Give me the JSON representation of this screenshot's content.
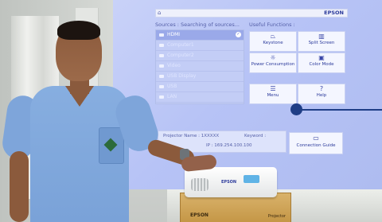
{
  "projection": {
    "brand": "EPSON",
    "sources_header": "Sources : Searching of sources...",
    "sources": [
      {
        "label": "HDMI",
        "selected": true
      },
      {
        "label": "Computer1",
        "selected": false
      },
      {
        "label": "Computer2",
        "selected": false
      },
      {
        "label": "Video",
        "selected": false
      },
      {
        "label": "USB Display",
        "selected": false
      },
      {
        "label": "USB",
        "selected": false
      },
      {
        "label": "LAN",
        "selected": false
      }
    ],
    "functions_header": "Useful Functions :",
    "functions": [
      {
        "label": "Keystone",
        "icon": "keystone-icon"
      },
      {
        "label": "Split Screen",
        "icon": "split-screen-icon"
      },
      {
        "label": "Power Consumption",
        "icon": "power-consumption-icon"
      },
      {
        "label": "Color Mode",
        "icon": "color-mode-icon"
      },
      {
        "label": "Menu",
        "icon": "menu-icon"
      },
      {
        "label": "Help",
        "icon": "help-icon"
      }
    ],
    "projector_name_label": "Projector Name : 1XXXXX",
    "keyword_label": "Keyword :",
    "ip_label": "IP : 169.254.100.100",
    "connection_guide": "Connection Guide"
  },
  "props": {
    "box_brand": "EPSON",
    "box_sub": "Projector",
    "projector_brand": "EPSON"
  },
  "colors": {
    "screen_bg": "#b7c3f6",
    "annotation": "#1f3e86",
    "scrubs": "#7ea5da"
  }
}
